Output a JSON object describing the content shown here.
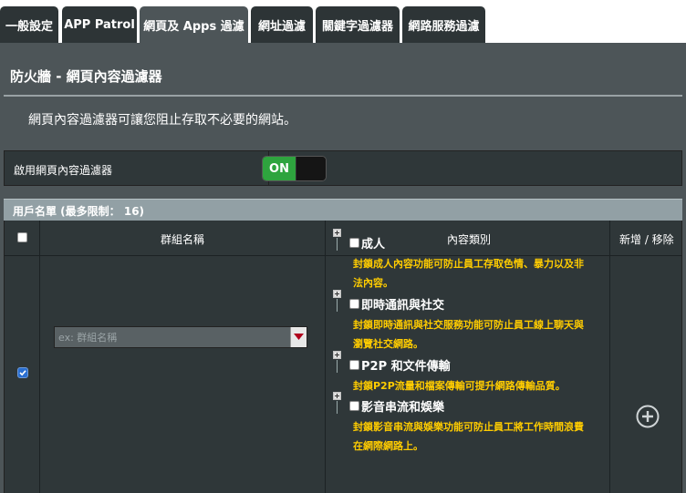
{
  "tabs": [
    {
      "label": "一般設定"
    },
    {
      "label": "APP Patrol"
    },
    {
      "label": "網頁及 Apps 過濾"
    },
    {
      "label": "網址過濾"
    },
    {
      "label": "關鍵字過濾器"
    },
    {
      "label": "網路服務過濾"
    }
  ],
  "page": {
    "title": "防火牆 - 網頁內容過濾器",
    "description": "網頁內容過濾器可讓您阻止存取不必要的網站。"
  },
  "enable": {
    "label": "啟用網頁內容過濾器",
    "toggle_label": "ON",
    "toggle_color": "#2ea43e"
  },
  "client_list": {
    "header": "用戶名單 (最多限制： 16)",
    "columns": {
      "group_name": "群組名稱",
      "category": "內容類別",
      "add_remove": "新增 / 移除"
    },
    "group_placeholder": "ex: 群組名稱",
    "categories": [
      {
        "title": "成人",
        "desc_lines": [
          "封鎖成人內容功能可防止員工存取色情、暴力以及非",
          "法內容。"
        ]
      },
      {
        "title": "即時通訊與社交",
        "desc_lines": [
          "封鎖即時通訊與社交服務功能可防止員工線上聊天與",
          "瀏覽社交網路。"
        ]
      },
      {
        "title": "P2P 和文件傳輸",
        "desc_lines": [
          "封鎖P2P流量和檔案傳輸可提升網路傳輸品質。"
        ]
      },
      {
        "title": "影音串流和娛樂",
        "desc_lines": [
          "封鎖影音串流與娛樂功能可防止員工將工作時間浪費",
          "在網際網路上。"
        ]
      }
    ]
  },
  "colors": {
    "accent_desc": "#ffcc00",
    "header_bar": "#92a0a5",
    "background": "#4d5558",
    "row_bg": "#2f3739"
  },
  "icons": [
    "chevron-down-icon",
    "add-circle-icon",
    "expand-icon",
    "check-icon"
  ]
}
